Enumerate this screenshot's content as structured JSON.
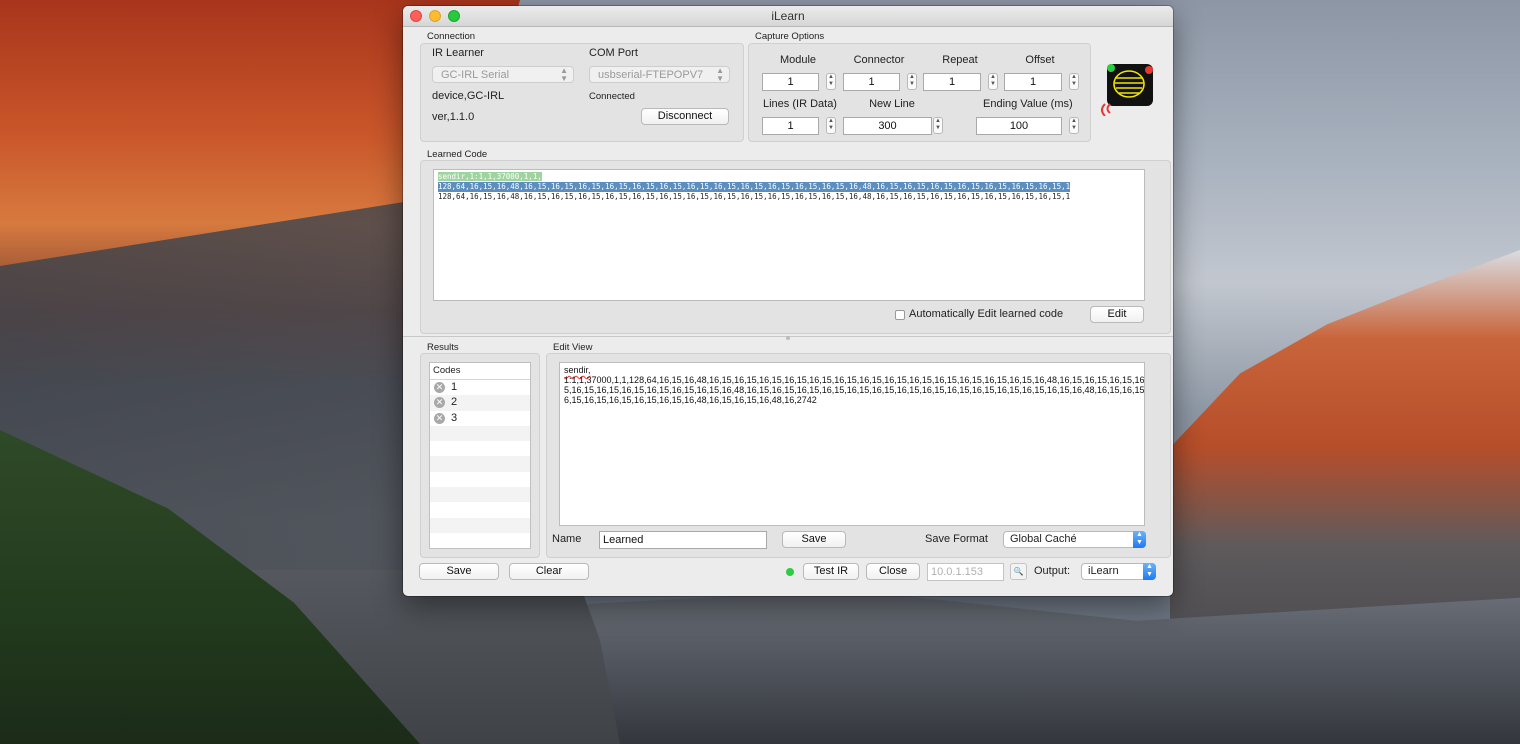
{
  "window": {
    "title": "iLearn"
  },
  "connection": {
    "section_label": "Connection",
    "ir_learner_label": "IR Learner",
    "com_port_label": "COM Port",
    "ir_learner_value": "GC-IRL Serial",
    "com_port_value": "usbserial-FTEPOPV7",
    "device_text": "device,GC-IRL",
    "version_text": "ver,1.1.0",
    "status_text": "Connected",
    "disconnect_label": "Disconnect"
  },
  "capture": {
    "section_label": "Capture Options",
    "module_label": "Module",
    "connector_label": "Connector",
    "repeat_label": "Repeat",
    "offset_label": "Offset",
    "module_value": "1",
    "connector_value": "1",
    "repeat_value": "1",
    "offset_value": "1",
    "lines_label": "Lines (IR Data)",
    "newline_label": "New Line",
    "ending_label": "Ending Value (ms)",
    "lines_value": "1",
    "newline_value": "300",
    "ending_value": "100"
  },
  "learned": {
    "section_label": "Learned Code",
    "line1": "sendir,1:1,1,37000,1,1,",
    "line2": "128,64,16,15,16,48,16,15,16,15,16,15,16,15,16,15,16,15,16,15,16,15,16,15,16,15,16,15,16,15,16,48,16,15,16,15,16,15,16,15,16,15,16,15,16,15,1",
    "line3": "128,64,16,15,16,48,16,15,16,15,16,15,16,15,16,15,16,15,16,15,16,15,16,15,16,15,16,15,16,15,16,48,16,15,16,15,16,15,16,15,16,15,16,15,16,15,1",
    "auto_edit_label": "Automatically Edit learned code",
    "edit_button": "Edit"
  },
  "results": {
    "section_label": "Results",
    "codes_header": "Codes",
    "codes": [
      "1",
      "2",
      "3"
    ],
    "save_label": "Save",
    "clear_label": "Clear"
  },
  "edit_view": {
    "section_label": "Edit View",
    "line1": "sendir,",
    "line2": "1:1,1,37000,1,1,128,64,16,15,16,48,16,15,16,15,16,15,16,15,16,15,16,15,16,15,16,15,16,15,16,15,16,15,16,15,16,15,16,48,16,15,16,15,16,15,16,1",
    "line3": "5,16,15,16,15,16,15,16,15,16,15,16,15,16,48,16,15,16,15,16,15,16,15,16,15,16,15,16,15,16,15,16,15,16,15,16,15,16,15,16,15,16,48,16,15,16,15,1",
    "line4": "6,15,16,15,16,15,16,15,16,15,16,48,16,15,16,15,16,48,16,2742",
    "name_label": "Name",
    "name_value": "Learned",
    "save_label": "Save",
    "save_format_label": "Save Format",
    "save_format_value": "Global Caché"
  },
  "footer": {
    "test_ir_label": "Test IR",
    "close_label": "Close",
    "ip_placeholder": "10.0.1.153",
    "output_label": "Output:",
    "output_value": "iLearn"
  },
  "colors": {
    "status_led": "#2ecc40",
    "select_accent": "#1f7af0",
    "learned_highlight_green": "#9fd39f",
    "learned_highlight_blue": "#5c8fbf"
  }
}
